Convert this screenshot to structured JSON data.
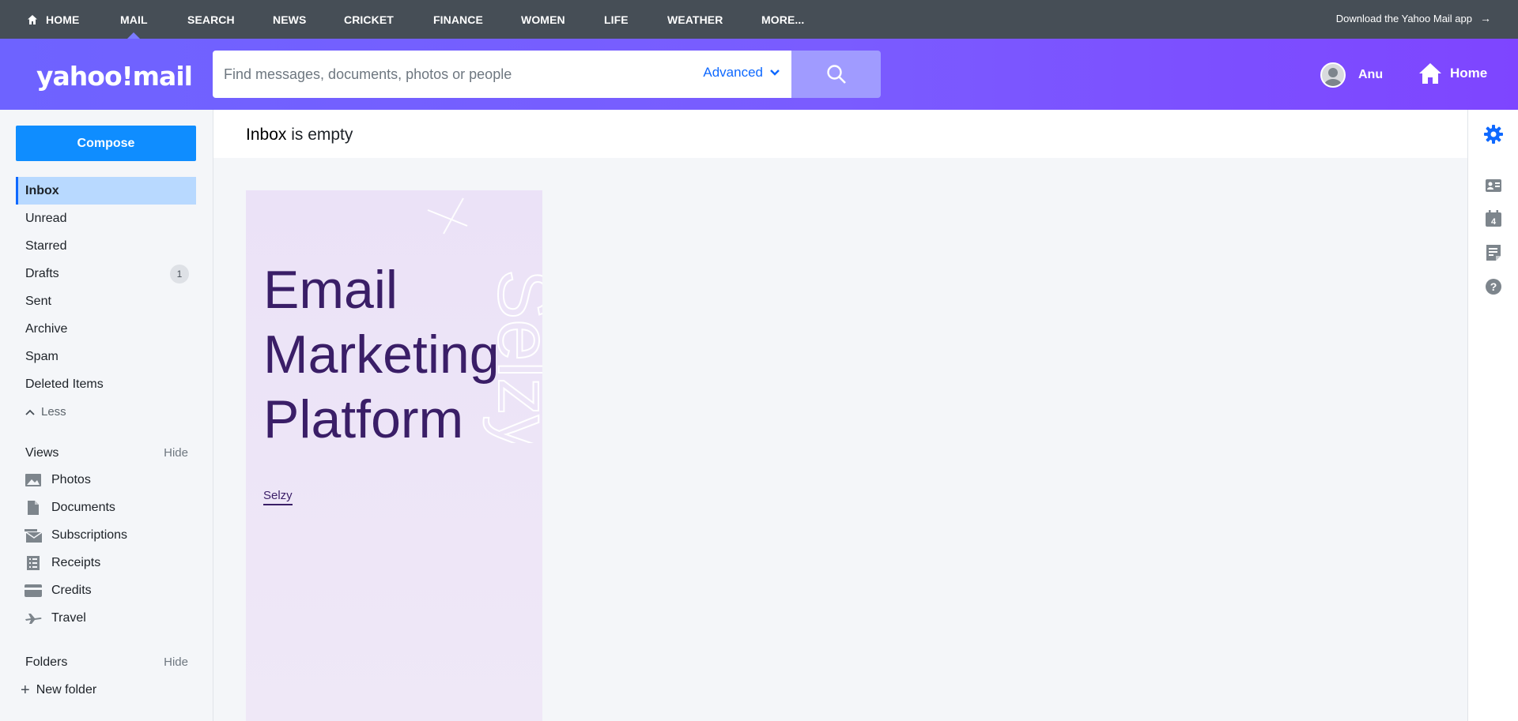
{
  "topnav": {
    "items": [
      {
        "label": "HOME"
      },
      {
        "label": "MAIL"
      },
      {
        "label": "SEARCH"
      },
      {
        "label": "NEWS"
      },
      {
        "label": "CRICKET"
      },
      {
        "label": "FINANCE"
      },
      {
        "label": "WOMEN"
      },
      {
        "label": "LIFE"
      },
      {
        "label": "WEATHER"
      },
      {
        "label": "MORE..."
      }
    ],
    "download_label": "Download the Yahoo Mail app",
    "download_arrow": "→"
  },
  "header": {
    "logo_text": "yahoo!mail",
    "search_placeholder": "Find messages, documents, photos or people",
    "advanced_label": "Advanced",
    "user_name": "Anu",
    "home_label": "Home"
  },
  "sidebar": {
    "compose_label": "Compose",
    "folders": [
      {
        "label": "Inbox",
        "active": true
      },
      {
        "label": "Unread"
      },
      {
        "label": "Starred"
      },
      {
        "label": "Drafts",
        "count": "1"
      },
      {
        "label": "Sent"
      },
      {
        "label": "Archive"
      },
      {
        "label": "Spam"
      },
      {
        "label": "Deleted Items"
      }
    ],
    "less_label": "Less",
    "views_heading": "Views",
    "views_hide": "Hide",
    "views": [
      {
        "label": "Photos",
        "icon": "photos-icon"
      },
      {
        "label": "Documents",
        "icon": "documents-icon"
      },
      {
        "label": "Subscriptions",
        "icon": "subscriptions-icon"
      },
      {
        "label": "Receipts",
        "icon": "receipts-icon"
      },
      {
        "label": "Credits",
        "icon": "credits-icon"
      },
      {
        "label": "Travel",
        "icon": "travel-icon"
      }
    ],
    "folders_heading": "Folders",
    "folders_hide": "Hide",
    "new_folder_label": "New folder"
  },
  "main": {
    "title_bold": "Inbox",
    "title_rest": " is empty",
    "ad": {
      "headline_lines": [
        "Email",
        "Marketing",
        "Platform"
      ],
      "brand": "Selzy"
    }
  },
  "rail": {
    "calendar_day": "4"
  },
  "colors": {
    "topnav_bg": "#464e56",
    "header_gradient_start": "#6e63ff",
    "header_gradient_end": "#7e45ff",
    "compose_bg": "#0f8dff",
    "active_folder_bg": "#b8d9ff",
    "ad_text": "#3a1e67",
    "ad_bg": "#ebe2f7"
  }
}
